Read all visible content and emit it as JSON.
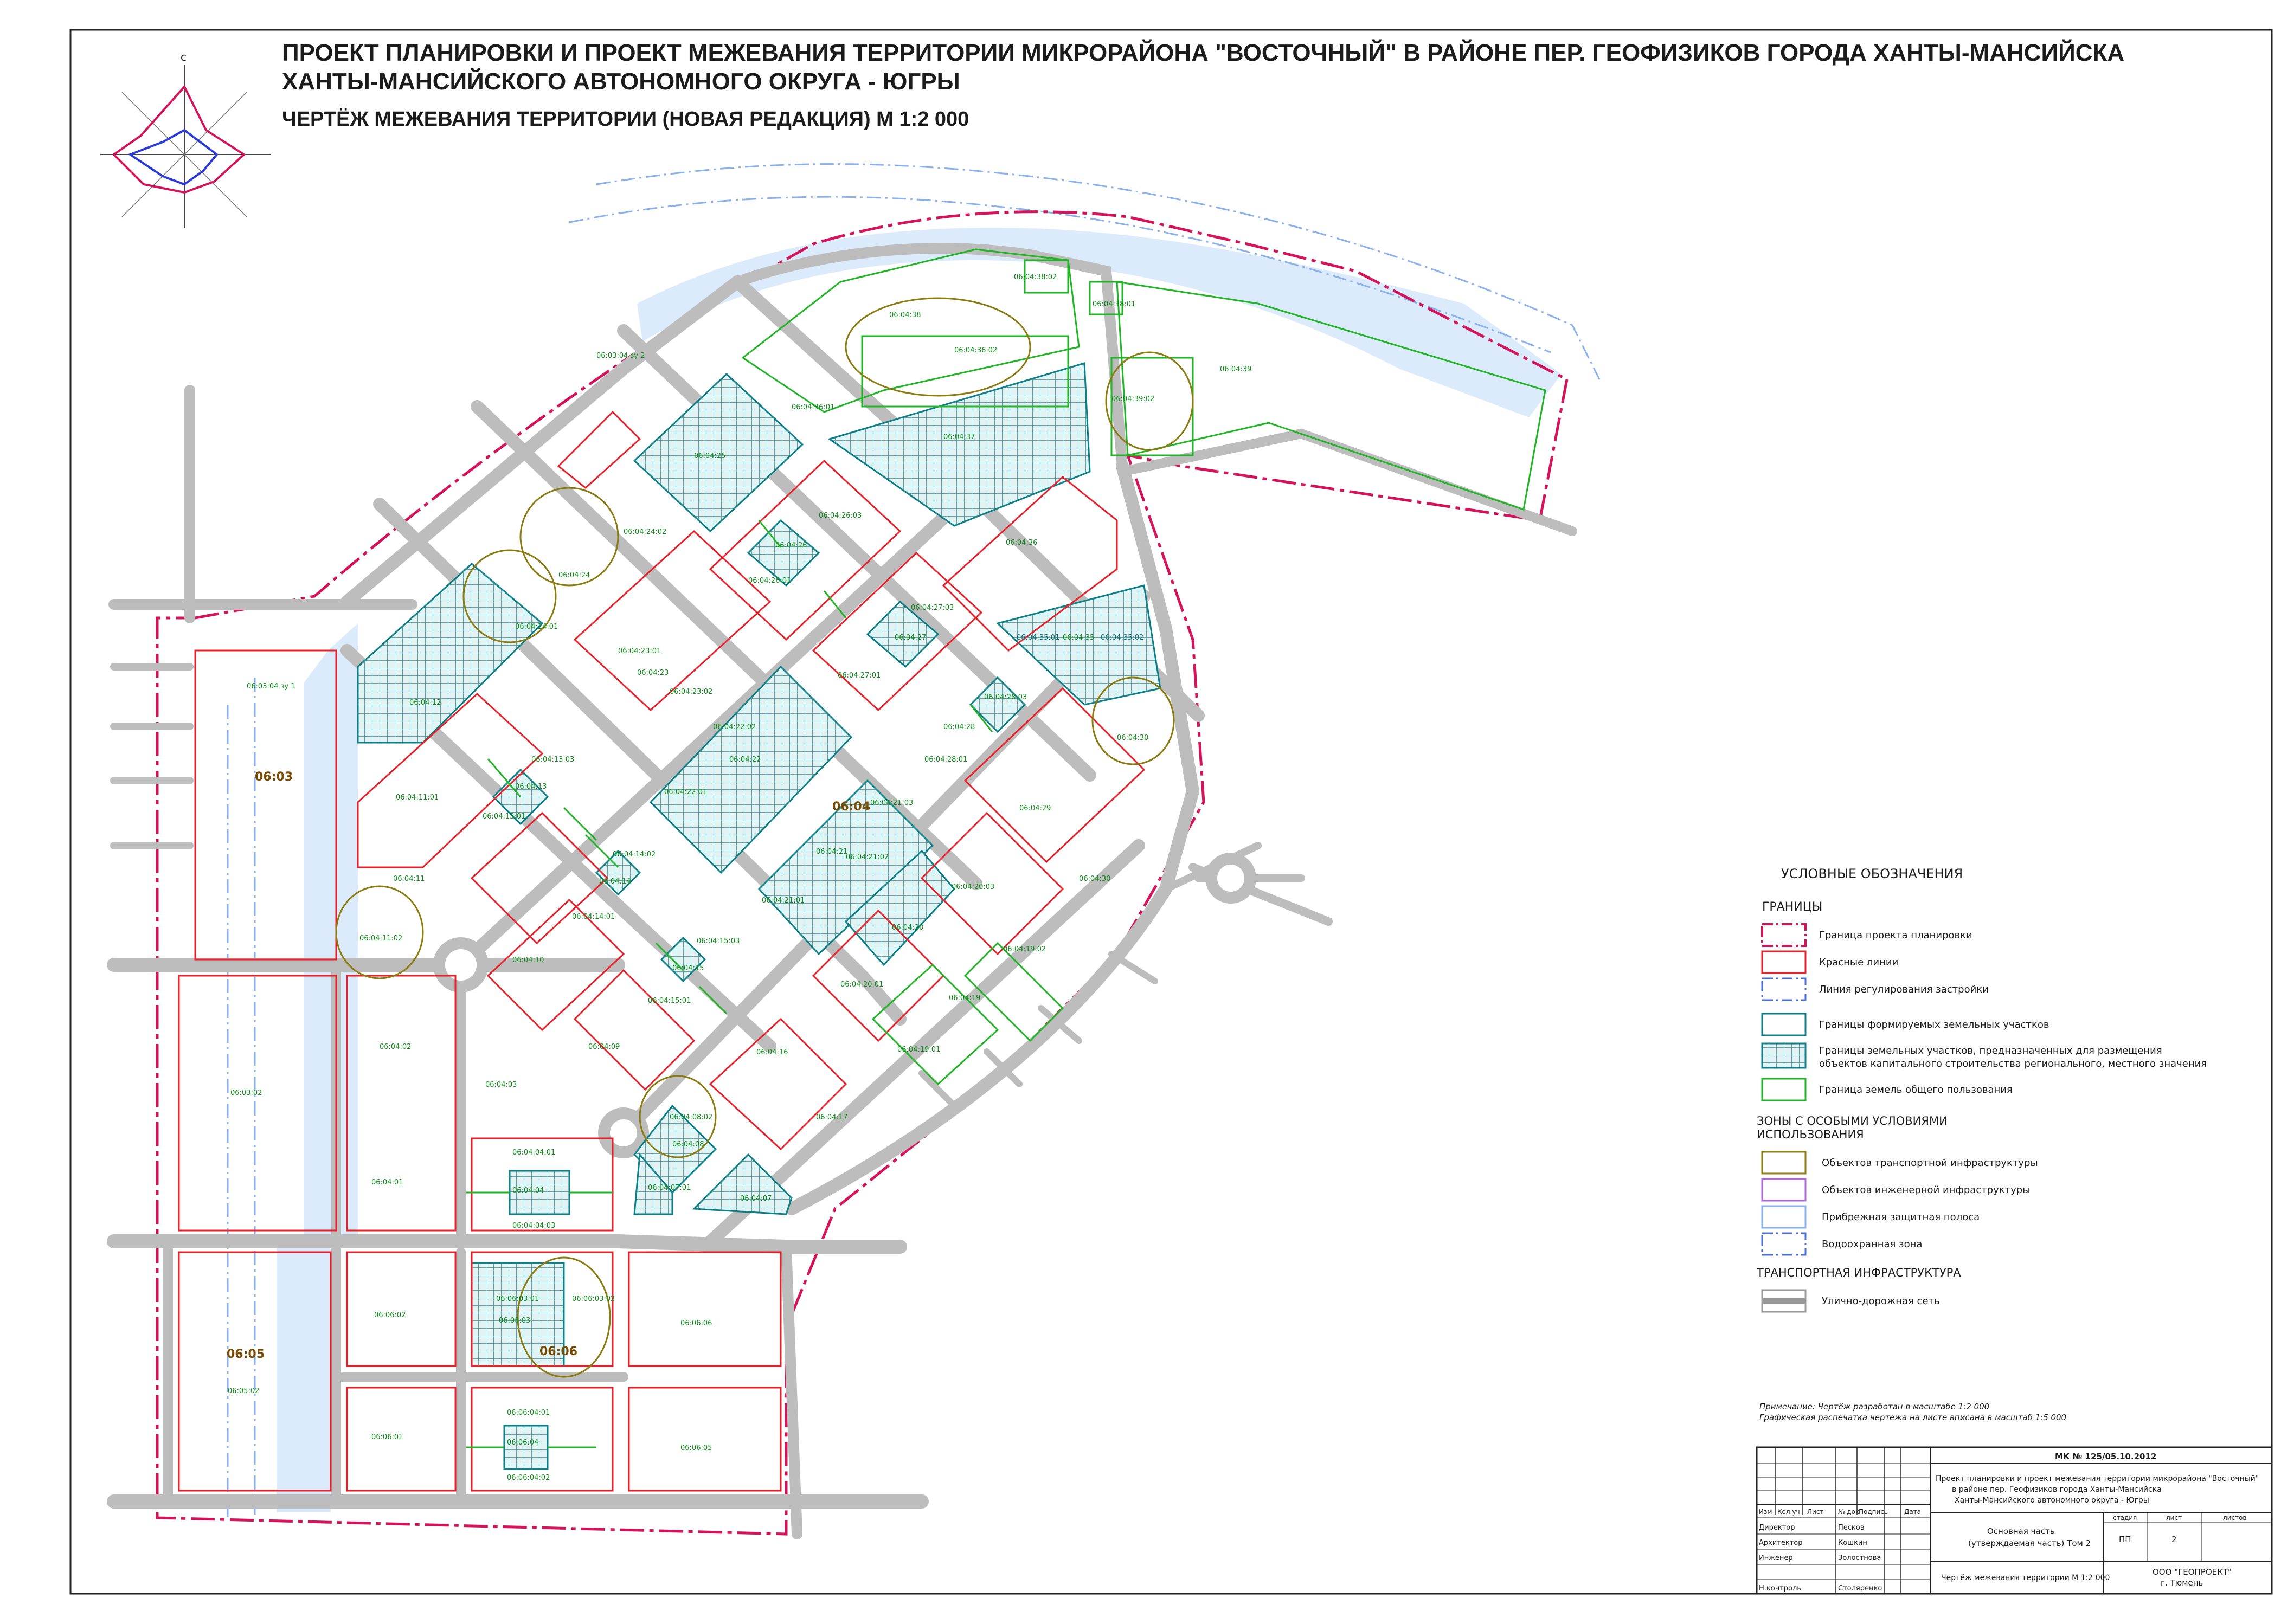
{
  "title": {
    "line1": "ПРОЕКТ ПЛАНИРОВКИ И ПРОЕКТ МЕЖЕВАНИЯ ТЕРРИТОРИИ МИКРОРАЙОНА \"ВОСТОЧНЫЙ\" В РАЙОНЕ ПЕР. ГЕОФИЗИКОВ ГОРОДА ХАНТЫ-МАНСИЙСКА",
    "line2": "ХАНТЫ-МАНСИЙСКОГО АВТОНОМНОГО ОКРУГА - ЮГРЫ",
    "subtitle": "ЧЕРТЁЖ МЕЖЕВАНИЯ ТЕРРИТОРИИ (НОВАЯ РЕДАКЦИЯ) М 1:2 000"
  },
  "compass": {
    "north_letter": "с"
  },
  "colors": {
    "project_boundary": "#d4145a",
    "red_lines": "#e8202a",
    "regulation_line": "#4a6fd8",
    "parcels": "#0f7f87",
    "public_land": "#1fb524",
    "transport_zone": "#8a7a10",
    "water": "#dcebfb",
    "road": "#b9b9b9"
  },
  "quarters": {
    "q0603": "06:03",
    "q0604": "06:04",
    "q0605": "06:05",
    "q0606": "06:06"
  },
  "map_labels": {
    "zu_0603_04_1": "06:03:04 зу 1",
    "zu_0603_04_2": "06:03:04 зу 2",
    "p0603_02": "06:03:02",
    "p0605_02": "06:05:02",
    "p0604_38": "06:04:38",
    "p0604_38_02": "06:04:38:02",
    "p0604_38_01": "06:04:38:01",
    "p0604_36_02": "06:04:36:02",
    "p0604_39": "06:04:39",
    "p0604_39_02": "06:04:39:02",
    "p0604_37": "06:04:37",
    "p0604_36_01": "06:04:36:01",
    "p0604_25": "06:04:25",
    "p0604_26_03": "06:04:26:03",
    "p0604_26": "06:04:26",
    "p0604_26_01": "06:04:26:01",
    "p0604_26_02": "06:04:26:02",
    "p0604_36": "06:04:36",
    "p0604_24_02": "06:04:24:02",
    "p0604_24": "06:04:24",
    "p0604_24_01": "06:04:24:01",
    "p0604_27_03": "06:04:27:03",
    "p0604_27": "06:04:27",
    "p0604_27_02": "06:04:27:02",
    "p0604_27_01": "06:04:27:01",
    "p0604_35": "06:04:35",
    "p0604_35_01": "06:04:35:01",
    "p0604_35_02": "06:04:35:02",
    "p0604_23_01": "06:04:23:01",
    "p0604_23": "06:04:23",
    "p0604_23_02": "06:04:23:02",
    "p0604_12": "06:04:12",
    "p0604_28_03": "06:04:28:03",
    "p0604_28": "06:04:28",
    "p0604_28_01": "06:04:28:01",
    "p0604_30": "06:04:30",
    "p0604_13_03": "06:04:13:03",
    "p0604_13": "06:04:13",
    "p0604_13_01": "06:04:13:01",
    "p0604_22_02": "06:04:22:02",
    "p0604_22": "06:04:22",
    "p0604_22_01": "06:04:22:01",
    "p0604_29": "06:04:29",
    "p0604_21_03": "06:04:21:03",
    "p0604_21": "06:04:21",
    "p0604_21_02": "06:04:21:02",
    "p0604_21_01": "06:04:21:01",
    "p0604_11_01": "06:04:11:01",
    "p0604_11": "06:04:11",
    "p0604_11_02": "06:04:11:02",
    "p0604_14_02": "06:04:14:02",
    "p0604_14": "06:04:14",
    "p0604_14_01": "06:04:14:01",
    "p0604_30_b": "06:04:30",
    "p0604_20_03": "06:04:20:03",
    "p0604_20": "06:04:20",
    "p0604_20_01": "06:04:20:01",
    "p0604_19_02": "06:04:19:02",
    "p0604_19": "06:04:19",
    "p0604_19_01": "06:04:19:01",
    "p0604_10": "06:04:10",
    "p0604_15_03": "06:04:15:03",
    "p0604_15": "06:04:15",
    "p0604_15_01": "06:04:15:01",
    "p0604_02": "06:04:02",
    "p0604_09": "06:04:09",
    "p0604_03": "06:04:03",
    "p0604_16": "06:04:16",
    "p0604_08_02": "06:04:08:02",
    "p0604_08": "06:04:08",
    "p0604_17": "06:04:17",
    "p0604_01": "06:04:01",
    "p0604_04_01": "06:04:04:01",
    "p0604_04": "06:04:04",
    "p0604_04_03": "06:04:04:03",
    "p0604_07_01": "06:04:07:01",
    "p0604_07": "06:04:07",
    "p0606_02": "06:06:02",
    "p0606_03_01": "06:06:03:01",
    "p0606_03": "06:06:03",
    "p0606_03_02": "06:06:03:02",
    "p0606_06": "06:06:06",
    "p0606_01": "06:06:01",
    "p0606_04_01": "06:06:04:01",
    "p0606_04": "06:06:04",
    "p0606_04_02": "06:06:04:02",
    "p0606_05": "06:06:05"
  },
  "legend": {
    "heading": "УСЛОВНЫЕ ОБОЗНАЧЕНИЯ",
    "borders_title": "ГРАНИЦЫ",
    "items": [
      "Граница проекта планировки",
      "Красные линии",
      "Линия регулирования застройки",
      "Границы формируемых земельных участков",
      "Границы земельных участков, предназначенных для размещения",
      "объектов капитального строительства регионального, местного значения",
      "Граница земель общего пользования"
    ],
    "zones_title_1": "ЗОНЫ С ОСОБЫМИ УСЛОВИЯМИ",
    "zones_title_2": "ИСПОЛЬЗОВАНИЯ",
    "zones": [
      "Объектов транспортной инфраструктуры",
      "Объектов инженерной инфраструктуры",
      "Прибрежная защитная полоса",
      "Водоохранная зона"
    ],
    "transport_title": "ТРАНСПОРТНАЯ ИНФРАСТРУКТУРА",
    "transport_item": "Улично-дорожная сеть"
  },
  "note": {
    "line1": "Примечание: Чертёж разработан в масштабе 1:2 000",
    "line2": "Графическая распечатка чертежа на листе вписана в масштаб 1:5 000"
  },
  "stamp": {
    "code": "МК № 125/05.10.2012",
    "desc1": "Проект планировки и проект межевания территории микрорайона \"Восточный\"",
    "desc2": "в районе пер. Геофизиков города Ханты-Мансийска",
    "desc3": "Ханты-Мансийского автономного округа - Югры",
    "cols": [
      "Изм",
      "Кол.уч",
      "Лист",
      "№ док",
      "Подпись",
      "Дата"
    ],
    "roles": [
      "Директор",
      "Архитектор",
      "Инженер",
      "",
      "Н.контроль"
    ],
    "names": [
      "Песков",
      "Кошкин",
      "Золостнова",
      "",
      "Столяренко"
    ],
    "part1": "Основная часть",
    "part2": "(утверждаемая часть) Том 2",
    "stage_h": "стадия",
    "sheet_h": "лист",
    "sheets_h": "листов",
    "stage": "ПП",
    "sheet": "2",
    "drawing": "Чертёж межевания территории М 1:2 000",
    "org1": "ООО \"ГЕОПРОЕКТ\"",
    "org2": "г. Тюмень"
  }
}
